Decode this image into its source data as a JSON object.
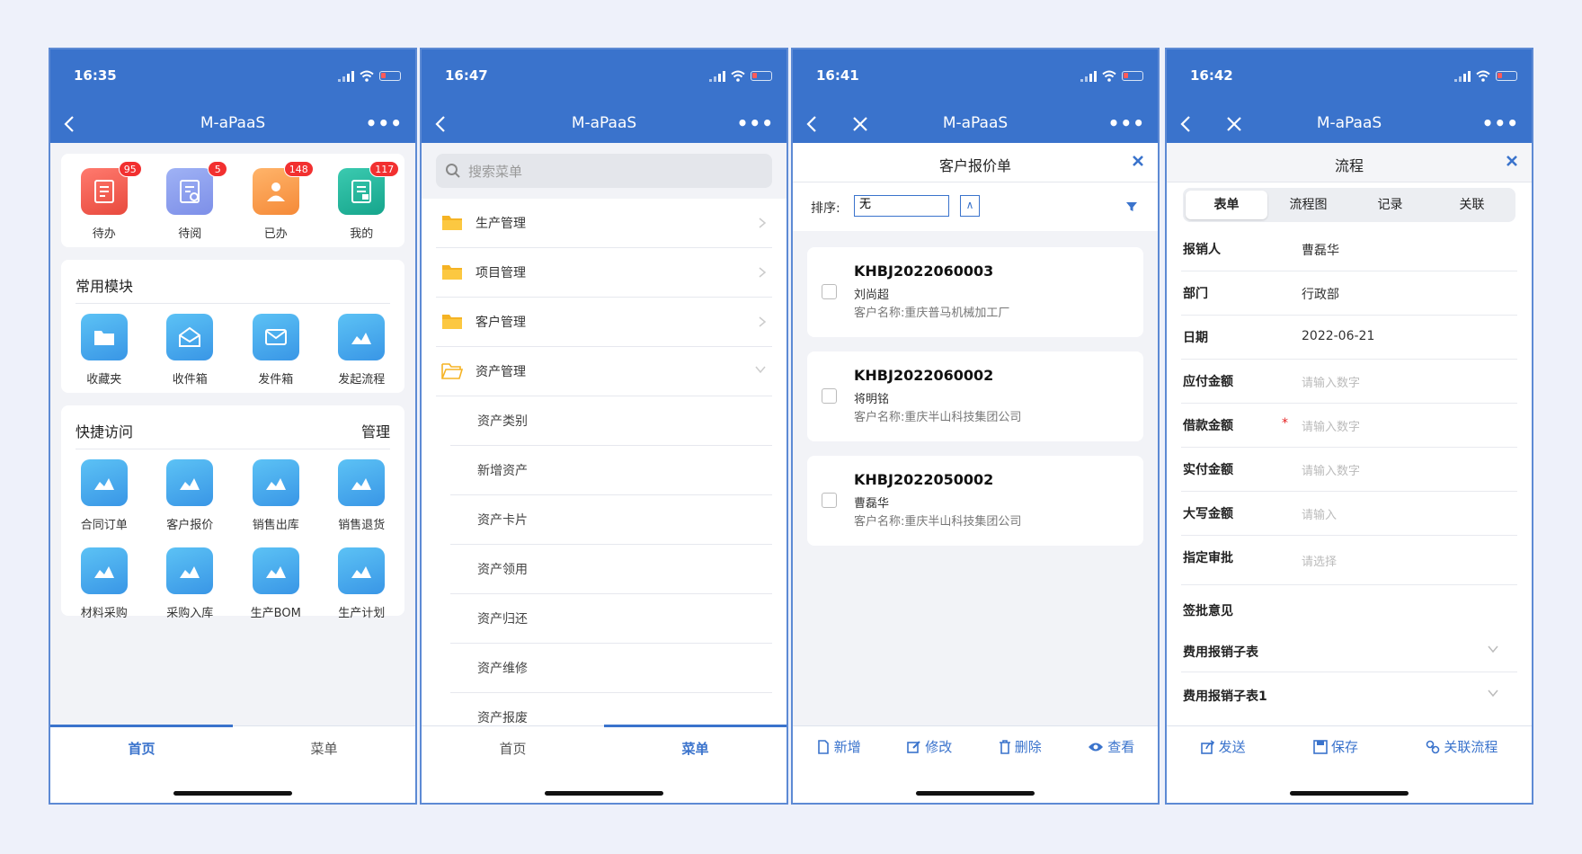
{
  "phones": [
    {
      "time": "16:35",
      "title": "M-aPaaS",
      "tabs": [
        "首页",
        "菜单"
      ],
      "top_items": [
        {
          "label": "待办",
          "badge": "95"
        },
        {
          "label": "待阅",
          "badge": "5"
        },
        {
          "label": "已办",
          "badge": "148"
        },
        {
          "label": "我的",
          "badge": "117"
        }
      ],
      "common_title": "常用模块",
      "common_items": [
        "收藏夹",
        "收件箱",
        "发件箱",
        "发起流程"
      ],
      "quick_title": "快捷访问",
      "quick_manage": "管理",
      "quick_items": [
        "合同订单",
        "客户报价",
        "销售出库",
        "销售退货",
        "材料采购",
        "采购入库",
        "生产BOM",
        "生产计划"
      ]
    },
    {
      "time": "16:47",
      "title": "M-aPaaS",
      "search_placeholder": "搜索菜单",
      "menu": [
        "生产管理",
        "项目管理",
        "客户管理",
        "资产管理"
      ],
      "submenu": [
        "资产类别",
        "新增资产",
        "资产卡片",
        "资产领用",
        "资产归还",
        "资产维修",
        "资产报废"
      ],
      "tabs": [
        "首页",
        "菜单"
      ]
    },
    {
      "time": "16:41",
      "title": "M-aPaaS",
      "sheet_title": "客户报价单",
      "sort_label": "排序:",
      "sort_value": "无",
      "sort_btn": "∧",
      "quotes": [
        {
          "code": "KHBJ2022060003",
          "name": "刘尚超",
          "customer": "客户名称:重庆普马机械加工厂"
        },
        {
          "code": "KHBJ2022060002",
          "name": "将明铭",
          "customer": "客户名称:重庆半山科技集团公司"
        },
        {
          "code": "KHBJ2022050002",
          "name": "曹磊华",
          "customer": "客户名称:重庆半山科技集团公司"
        }
      ],
      "actions": [
        "新增",
        "修改",
        "删除",
        "查看"
      ]
    },
    {
      "time": "16:42",
      "title": "M-aPaaS",
      "sheet_title": "流程",
      "segments": [
        "表单",
        "流程图",
        "记录",
        "关联"
      ],
      "fields": [
        {
          "label": "报销人",
          "value": "曹磊华"
        },
        {
          "label": "部门",
          "value": "行政部"
        },
        {
          "label": "日期",
          "value": "2022-06-21"
        },
        {
          "label": "应付金额",
          "placeholder": "请输入数字"
        },
        {
          "label": "借款金额",
          "placeholder": "请输入数字",
          "required": "*"
        },
        {
          "label": "实付金额",
          "placeholder": "请输入数字"
        },
        {
          "label": "大写金额",
          "placeholder": "请输入"
        },
        {
          "label": "指定审批",
          "placeholder": "请选择"
        },
        {
          "label": "签批意见"
        },
        {
          "label": "费用报销子表"
        },
        {
          "label": "费用报销子表1"
        }
      ],
      "actions": [
        "发送",
        "保存",
        "关联流程"
      ]
    }
  ],
  "colors": {
    "primary": "#3a73cc",
    "badge": "#f23030",
    "bg": "#f2f3f7"
  }
}
